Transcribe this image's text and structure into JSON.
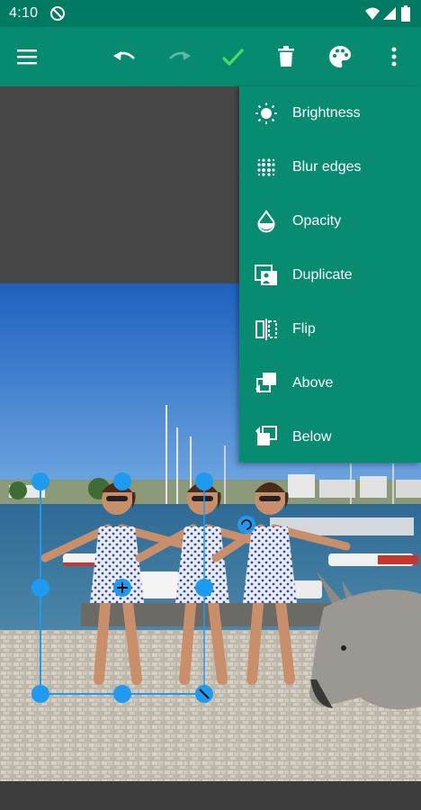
{
  "status_bar": {
    "time": "4:10",
    "icons": [
      "do-not-disturb-icon",
      "wifi-icon",
      "signal-icon",
      "battery-icon"
    ]
  },
  "toolbar": {
    "buttons": [
      "menu-icon",
      "undo-icon",
      "redo-icon",
      "check-icon",
      "delete-icon",
      "palette-icon",
      "more-vert-icon"
    ],
    "accent_color": "#068b70",
    "check_color": "#4cd964"
  },
  "menu": {
    "items": [
      {
        "label": "Brightness",
        "icon": "brightness-icon"
      },
      {
        "label": "Blur edges",
        "icon": "blur-edges-icon"
      },
      {
        "label": "Opacity",
        "icon": "opacity-icon"
      },
      {
        "label": "Duplicate",
        "icon": "duplicate-icon"
      },
      {
        "label": "Flip",
        "icon": "flip-icon"
      },
      {
        "label": "Above",
        "icon": "above-icon"
      },
      {
        "label": "Below",
        "icon": "below-icon"
      }
    ]
  },
  "selection": {
    "handle_color": "#1e9bf0",
    "handles": [
      "top-left",
      "top-center",
      "top-right",
      "middle-left",
      "center-move",
      "middle-right",
      "bottom-left",
      "bottom-center",
      "bottom-right-scale",
      "rotate"
    ]
  }
}
